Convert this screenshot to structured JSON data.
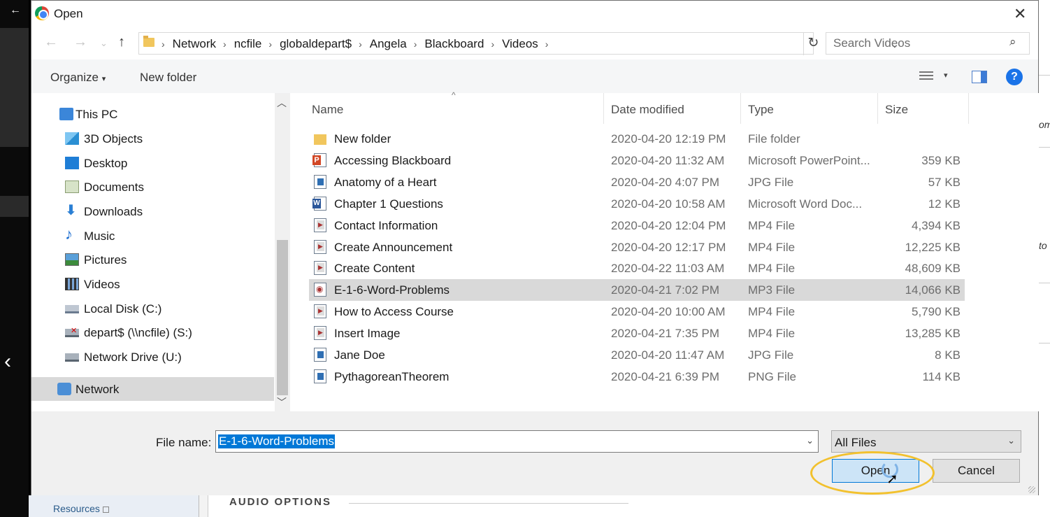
{
  "background": {
    "resources_label": "Resources",
    "audio_options_label": "AUDIO OPTIONS",
    "right_fragments": [
      "om",
      "to"
    ]
  },
  "dialog": {
    "title": "Open",
    "breadcrumbs": [
      "Network",
      "ncfile",
      "globaldepart$",
      "Angela",
      "Blackboard",
      "Videos"
    ],
    "search_placeholder": "Search Videos",
    "toolbar": {
      "organize": "Organize",
      "new_folder": "New folder"
    },
    "nav_items": [
      {
        "label": "This PC",
        "icon": "this-pc-icon"
      },
      {
        "label": "3D Objects",
        "icon": "3d-objects-icon"
      },
      {
        "label": "Desktop",
        "icon": "desktop-icon"
      },
      {
        "label": "Documents",
        "icon": "documents-icon"
      },
      {
        "label": "Downloads",
        "icon": "downloads-icon"
      },
      {
        "label": "Music",
        "icon": "music-icon"
      },
      {
        "label": "Pictures",
        "icon": "pictures-icon"
      },
      {
        "label": "Videos",
        "icon": "videos-icon"
      },
      {
        "label": "Local Disk (C:)",
        "icon": "local-disk-icon"
      },
      {
        "label": "depart$ (\\\\ncfile) (S:)",
        "icon": "disconnected-network-drive-icon"
      },
      {
        "label": "Network Drive (U:)",
        "icon": "network-drive-icon"
      },
      {
        "label": "Network",
        "icon": "network-icon"
      }
    ],
    "columns": {
      "name": "Name",
      "date": "Date modified",
      "type": "Type",
      "size": "Size"
    },
    "files": [
      {
        "name": "New folder",
        "date": "2020-04-20 12:19 PM",
        "type": "File folder",
        "size": "",
        "icon": "folder"
      },
      {
        "name": "Accessing Blackboard",
        "date": "2020-04-20 11:32 AM",
        "type": "Microsoft PowerPoint...",
        "size": "359 KB",
        "icon": "ppt"
      },
      {
        "name": "Anatomy of a Heart",
        "date": "2020-04-20 4:07 PM",
        "type": "JPG File",
        "size": "57 KB",
        "icon": "img"
      },
      {
        "name": "Chapter 1 Questions",
        "date": "2020-04-20 10:58 AM",
        "type": "Microsoft Word Doc...",
        "size": "12 KB",
        "icon": "docx"
      },
      {
        "name": "Contact Information",
        "date": "2020-04-20 12:04 PM",
        "type": "MP4 File",
        "size": "4,394 KB",
        "icon": "video"
      },
      {
        "name": "Create Announcement",
        "date": "2020-04-20 12:17 PM",
        "type": "MP4 File",
        "size": "12,225 KB",
        "icon": "video"
      },
      {
        "name": "Create Content",
        "date": "2020-04-22 11:03 AM",
        "type": "MP4 File",
        "size": "48,609 KB",
        "icon": "video"
      },
      {
        "name": "E-1-6-Word-Problems",
        "date": "2020-04-21 7:02 PM",
        "type": "MP3 File",
        "size": "14,066 KB",
        "icon": "audio"
      },
      {
        "name": "How to Access Course",
        "date": "2020-04-20 10:00 AM",
        "type": "MP4 File",
        "size": "5,790 KB",
        "icon": "video"
      },
      {
        "name": "Insert Image",
        "date": "2020-04-21 7:35 PM",
        "type": "MP4 File",
        "size": "13,285 KB",
        "icon": "video"
      },
      {
        "name": "Jane Doe",
        "date": "2020-04-20 11:47 AM",
        "type": "JPG File",
        "size": "8 KB",
        "icon": "img"
      },
      {
        "name": "PythagoreanTheorem",
        "date": "2020-04-21 6:39 PM",
        "type": "PNG File",
        "size": "114 KB",
        "icon": "img"
      }
    ],
    "file_name_label": "File name:",
    "file_name_value": "E-1-6-Word-Problems",
    "file_type_value": "All Files",
    "open_label": "Open",
    "cancel_label": "Cancel",
    "help_glyph": "?"
  }
}
